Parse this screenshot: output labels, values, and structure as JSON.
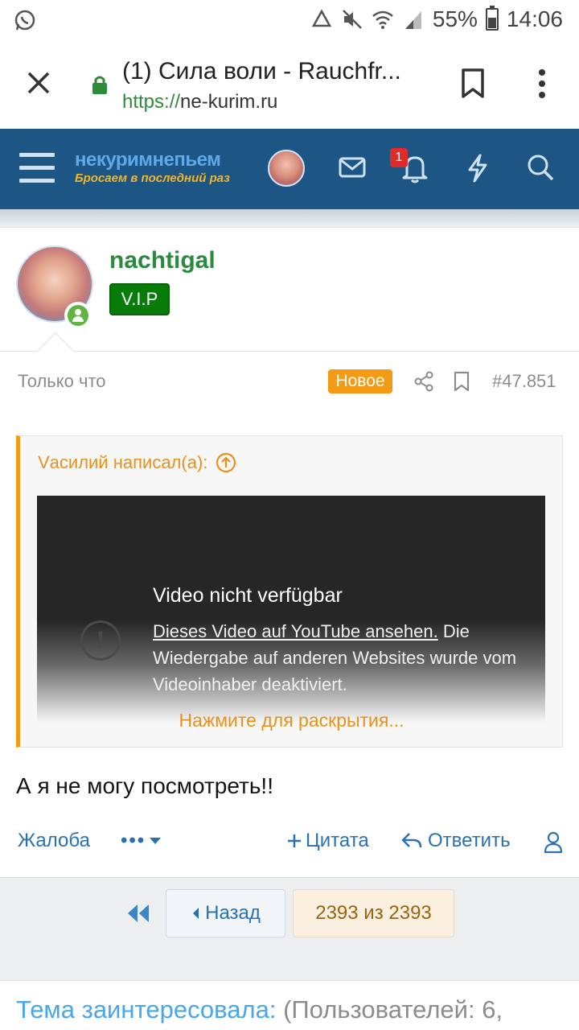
{
  "status_bar": {
    "battery": "55%",
    "time": "14:06",
    "battery_level": 0.55
  },
  "browser": {
    "tab_title": "(1) Сила воли - Rauchfr...",
    "url_scheme": "https://",
    "url_host": "ne-kurim.ru"
  },
  "site_nav": {
    "logo_line1": "некуримнепьем",
    "logo_line2": "Бросаем в последний раз",
    "notification_count": "1"
  },
  "post": {
    "username": "nachtigal",
    "user_badge": "V.I.P",
    "time": "Только что",
    "new_label": "Новое",
    "post_number": "#47.851",
    "quote": {
      "header": "Vасилий написал(а):",
      "video_title": "Video nicht verfügbar",
      "video_link": "Dieses Video auf YouTube ansehen.",
      "video_text": " Die Wiedergabe auf anderen Websites wurde vom Videoinhaber deaktiviert.",
      "expand_label": "Нажмите для раскрытия..."
    },
    "body": "А я не могу посмотреть!!",
    "actions": {
      "complain": "Жалоба",
      "quote": "Цитата",
      "reply": "Ответить"
    }
  },
  "pagination": {
    "back_label": "Назад",
    "pages_label": "2393 из 2393"
  },
  "footer": {
    "interest_label": "Тема заинтересовала:",
    "users_text": " (Пользователей: 6,"
  }
}
